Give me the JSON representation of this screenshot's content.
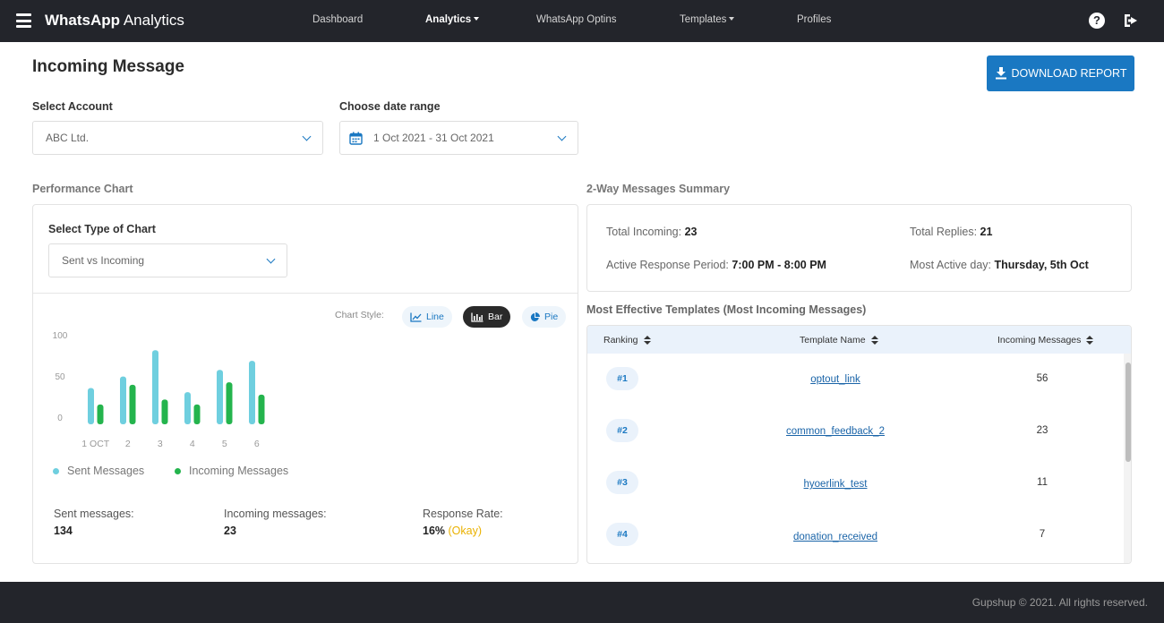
{
  "nav": {
    "brand_bold": "WhatsApp",
    "brand_rest": " Analytics",
    "items": [
      {
        "label": "Dashboard"
      },
      {
        "label": "Analytics"
      },
      {
        "label": "WhatsApp Optins"
      },
      {
        "label": "Templates"
      },
      {
        "label": "Profiles"
      }
    ],
    "help_glyph": "?"
  },
  "header": {
    "title": "Incoming Message",
    "download_label": "DOWNLOAD REPORT"
  },
  "filters": {
    "account_label": "Select Account",
    "account_value": "ABC Ltd.",
    "date_label": "Choose date range",
    "date_value": "1 Oct 2021 - 31 Oct 2021"
  },
  "performance": {
    "section_title": "Performance Chart",
    "chart_type_label": "Select Type of Chart",
    "chart_type_value": "Sent vs Incoming",
    "chart_style_label": "Chart Style:",
    "styles": [
      {
        "label": "Line"
      },
      {
        "label": "Bar"
      },
      {
        "label": "Pie"
      }
    ],
    "legend": [
      {
        "label": "Sent Messages",
        "color": "#6fcfdf"
      },
      {
        "label": "Incoming Messages",
        "color": "#24b44d"
      }
    ],
    "stats": [
      {
        "label": "Sent messages:",
        "value": "134"
      },
      {
        "label": "Incoming messages:",
        "value": "23"
      },
      {
        "label": "Response Rate:",
        "value": "16%",
        "note": "(Okay)"
      }
    ]
  },
  "chart_data": {
    "type": "bar",
    "categories": [
      "1 OCT",
      "2",
      "3",
      "4",
      "5",
      "6"
    ],
    "series": [
      {
        "name": "Sent Messages",
        "color": "#6fcfdf",
        "values": [
          44,
          58,
          90,
          39,
          66,
          77
        ]
      },
      {
        "name": "Incoming Messages",
        "color": "#24b44d",
        "values": [
          24,
          48,
          30,
          24,
          51,
          36
        ]
      }
    ],
    "yticks": [
      "100",
      "50",
      "0"
    ],
    "ylim": [
      0,
      100
    ],
    "grid": false,
    "legend_position": "bottom-left"
  },
  "summary": {
    "section_title": "2-Way Messages Summary",
    "total_incoming_label": "Total Incoming:",
    "total_incoming_value": "23",
    "total_replies_label": "Total Replies:",
    "total_replies_value": "21",
    "active_period_label": "Active Response Period:",
    "active_period_value": "7:00 PM - 8:00 PM",
    "active_day_label": "Most Active day:",
    "active_day_value": "Thursday, 5th Oct"
  },
  "templates": {
    "section_title": "Most Effective Templates (Most Incoming Messages)",
    "columns": [
      "Ranking",
      "Template Name",
      "Incoming Messages"
    ],
    "rows": [
      {
        "rank": "#1",
        "name": "optout_link",
        "count": "56"
      },
      {
        "rank": "#2",
        "name": "common_feedback_2",
        "count": "23"
      },
      {
        "rank": "#3",
        "name": "hyoerlink_test",
        "count": "11"
      },
      {
        "rank": "#4",
        "name": "donation_received",
        "count": "7"
      }
    ]
  },
  "footer": {
    "text": "Gupshup © 2021. All rights reserved."
  }
}
